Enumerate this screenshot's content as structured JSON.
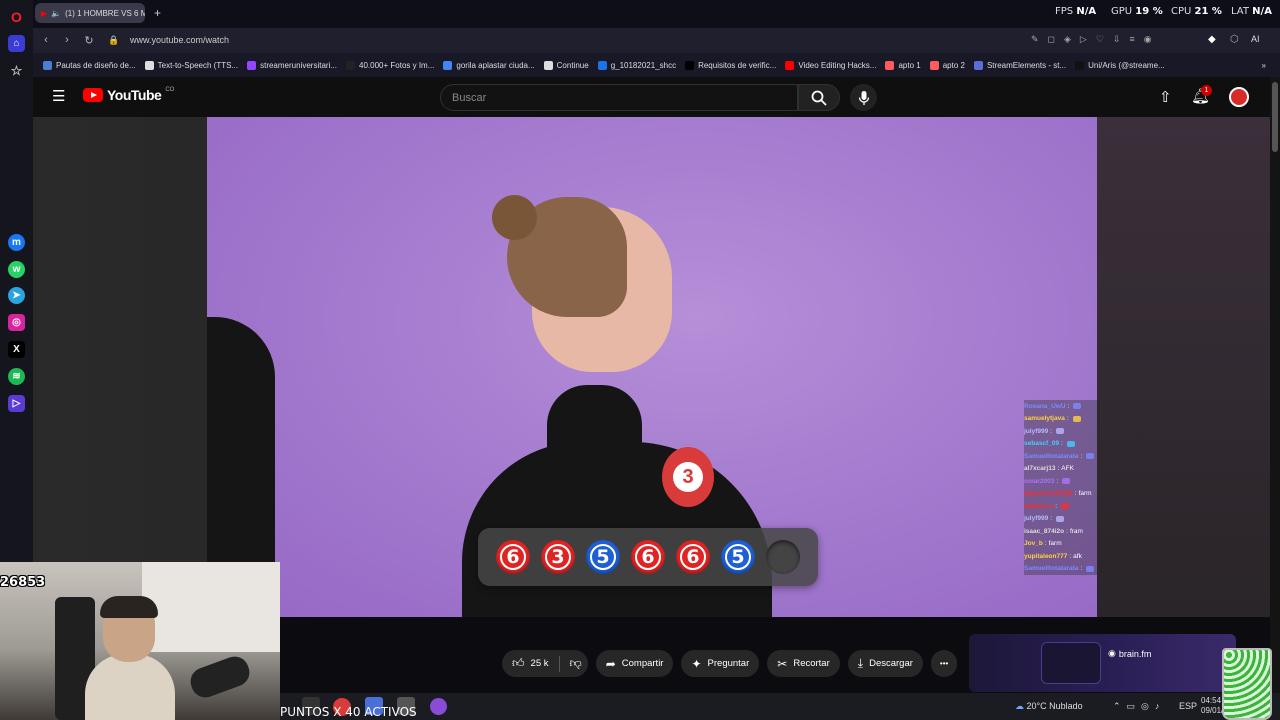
{
  "browser": {
    "active_tab_title": "(1) 1 HOMBRE VS 6 M",
    "new_tab_label": "+",
    "url": "www.youtube.com/watch",
    "perf": {
      "fps_label": "FPS",
      "fps_value": "N/A",
      "gpu_label": "GPU",
      "gpu_value": "19 %",
      "cpu_label": "CPU",
      "cpu_value": "21 %",
      "lat_label": "LAT",
      "lat_value": "N/A"
    },
    "ai_label": "AI",
    "bookmarks": [
      {
        "label": "Pautas de diseño de...",
        "color": "#4a7fd4"
      },
      {
        "label": "Text-to-Speech (TTS...",
        "color": "#dddddd"
      },
      {
        "label": "streameruniversitari...",
        "color": "#9146ff"
      },
      {
        "label": "40.000+ Fotos y Im...",
        "color": "#222222"
      },
      {
        "label": "gorila aplastar ciuda...",
        "color": "#4285f4"
      },
      {
        "label": "Continue",
        "color": "#dddddd"
      },
      {
        "label": "g_10182021_shcc",
        "color": "#1a73e8"
      },
      {
        "label": "Requisitos de verific...",
        "color": "#000000"
      },
      {
        "label": "Video Editing Hacks...",
        "color": "#ff0000"
      },
      {
        "label": "apto 1",
        "color": "#ff5a5f"
      },
      {
        "label": "apto 2",
        "color": "#ff5a5f"
      },
      {
        "label": "StreamElements - st...",
        "color": "#5a6fd6"
      },
      {
        "label": "Uni/Aris (@streame...",
        "color": "#111111"
      }
    ]
  },
  "youtube": {
    "logo_text": "YouTube",
    "logo_country": "CO",
    "search_placeholder": "Buscar",
    "notifications_count": "1",
    "actions": {
      "likes": "25 k",
      "share": "Compartir",
      "ask": "Preguntar",
      "clip": "Recortar",
      "download": "Descargar",
      "more": "•••"
    }
  },
  "video": {
    "badge_number": "3",
    "balls": [
      {
        "number": "6",
        "color": "#e02424"
      },
      {
        "number": "3",
        "color": "#e02424"
      },
      {
        "number": "5",
        "color": "#1e5fd6"
      },
      {
        "number": "6",
        "color": "#e02424"
      },
      {
        "number": "6",
        "color": "#e02424"
      },
      {
        "number": "5",
        "color": "#1e5fd6"
      }
    ]
  },
  "chat": [
    {
      "nick": "Roxana_UwU",
      "msg": "",
      "color": "#7b8cff"
    },
    {
      "nick": "samuelytjava",
      "msg": "",
      "color": "#ffd23f"
    },
    {
      "nick": "julyf999",
      "msg": "",
      "color": "#b8b8ff"
    },
    {
      "nick": "sebascf_09",
      "msg": "",
      "color": "#3fd1ff"
    },
    {
      "nick": "Samuelitotatarata",
      "msg": "",
      "color": "#7b8cff"
    },
    {
      "nick": "al7xcarj13",
      "msg": "AFK",
      "color": "#dddddd"
    },
    {
      "nick": "omar2003",
      "msg": "",
      "color": "#b070ff"
    },
    {
      "nick": "papucho122356",
      "msg": "farm",
      "color": "#ff2a2a"
    },
    {
      "nick": "Adimos.a",
      "msg": "",
      "color": "#ff2a2a"
    },
    {
      "nick": "julyf999",
      "msg": "",
      "color": "#b8b8ff"
    },
    {
      "nick": "isaac_874i2o",
      "msg": "fram",
      "color": "#dddddd"
    },
    {
      "nick": "Jov_b",
      "msg": "farm",
      "color": "#ffd23f"
    },
    {
      "nick": "yupitaleon777",
      "msg": "afk",
      "color": "#ffd23f"
    },
    {
      "nick": "Samuelitotatarata",
      "msg": "",
      "color": "#7b8cff"
    }
  ],
  "ad": {
    "brand": "brain.fm"
  },
  "stream": {
    "counter": "26853",
    "points_text": "PUNTOS X 40 ACTIVOS"
  },
  "taskbar": {
    "weather": "20°C Nublado",
    "language": "ESP",
    "time": "04:54",
    "date": "09/01/"
  }
}
